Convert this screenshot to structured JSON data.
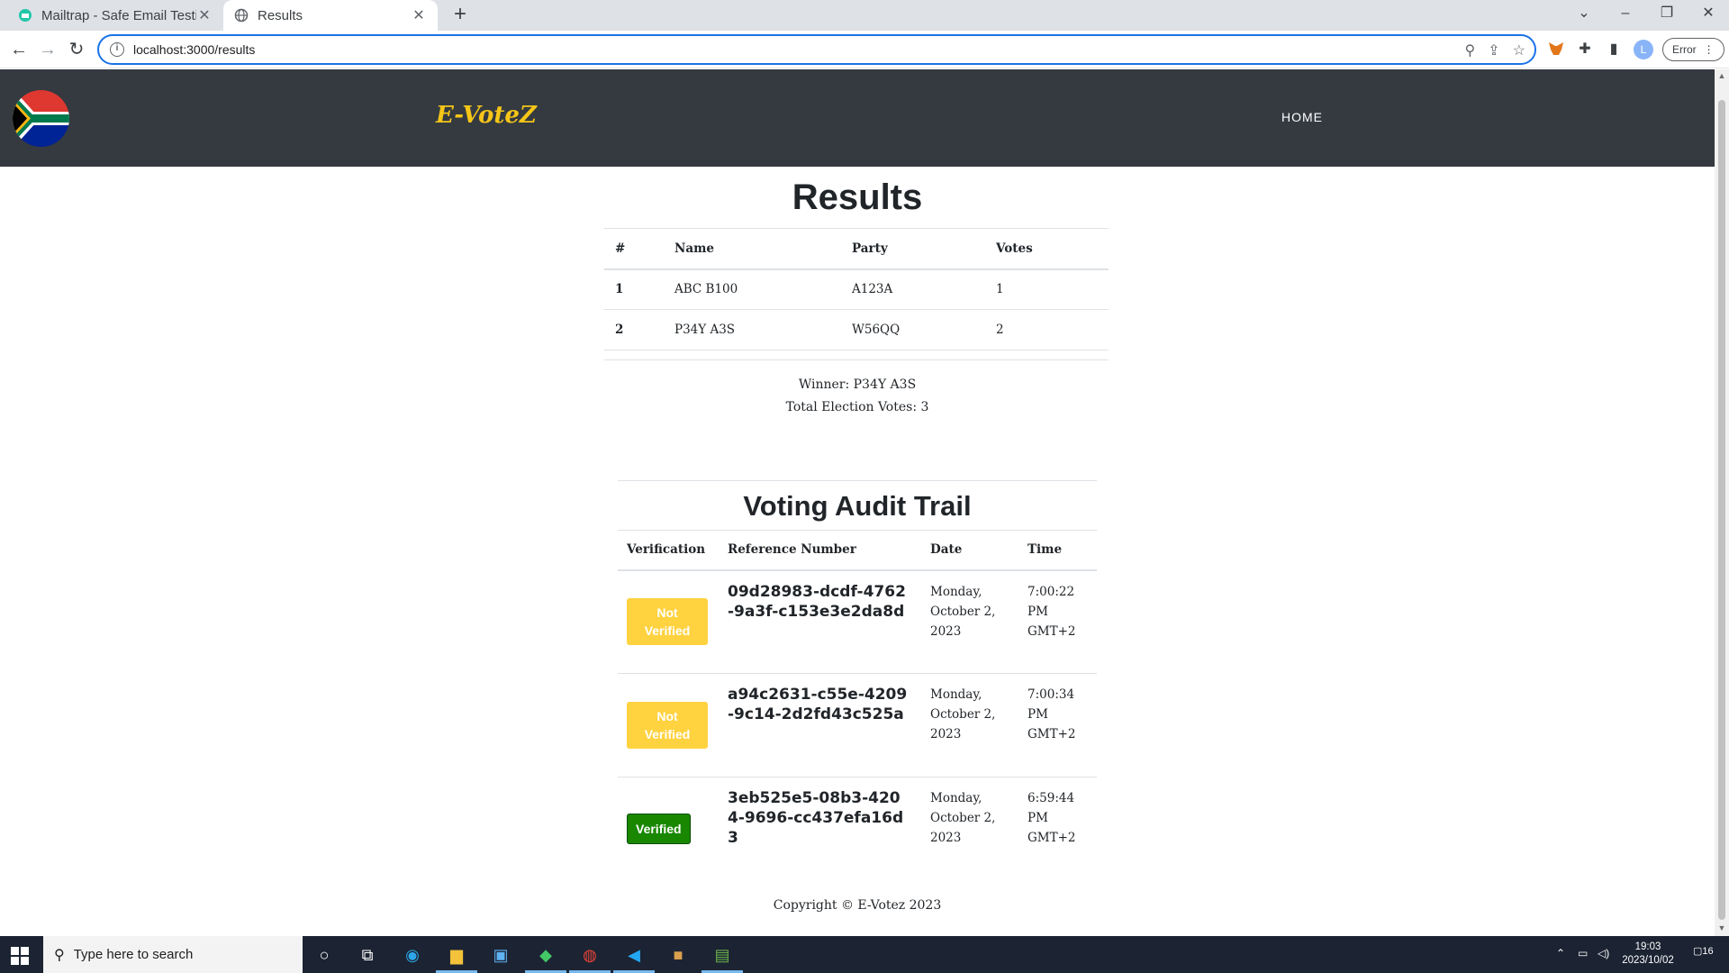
{
  "browser": {
    "tabs": [
      {
        "title": "Mailtrap - Safe Email Testing",
        "active": false
      },
      {
        "title": "Results",
        "active": true
      }
    ],
    "url": "localhost:3000/results",
    "error_label": "Error",
    "profile_initial": "L"
  },
  "site": {
    "brand": "E-VoteZ",
    "nav_home": "HOME"
  },
  "results": {
    "title": "Results",
    "headers": [
      "#",
      "Name",
      "Party",
      "Votes"
    ],
    "rows": [
      {
        "num": "1",
        "name": "ABC B100",
        "party": "A123A",
        "votes": "1"
      },
      {
        "num": "2",
        "name": "P34Y A3S",
        "party": "W56QQ",
        "votes": "2"
      }
    ],
    "winner": "Winner: P34Y A3S",
    "total": "Total Election Votes: 3"
  },
  "audit": {
    "title": "Voting Audit Trail",
    "headers": [
      "Verification",
      "Reference Number",
      "Date",
      "Time"
    ],
    "rows": [
      {
        "status": "Not Verified",
        "reference": "09d28983-dcdf-4762-9a3f-c153e3e2da8d",
        "date": "Monday, October 2, 2023",
        "time": "7:00:22 PM GMT+2"
      },
      {
        "status": "Not Verified",
        "reference": "a94c2631-c55e-4209-9c14-2d2fd43c525a",
        "date": "Monday, October 2, 2023",
        "time": "7:00:34 PM GMT+2"
      },
      {
        "status": "Verified",
        "reference": "3eb525e5-08b3-4204-9696-cc437efa16d3",
        "date": "Monday, October 2, 2023",
        "time": "6:59:44 PM GMT+2"
      }
    ]
  },
  "footer": "Copyright © E-Votez 2023",
  "taskbar": {
    "search_placeholder": "Type here to search",
    "time": "19:03",
    "date": "2023/10/02",
    "notifications": "16"
  },
  "colors": {
    "navbar": "#343a40",
    "brand": "#f5c518",
    "not_verified": "#ffd23f",
    "verified": "#198700"
  }
}
